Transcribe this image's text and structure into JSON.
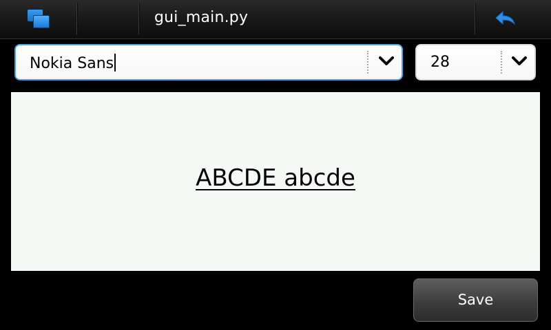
{
  "titlebar": {
    "task_switcher_icon": "task-switcher-icon",
    "title": "gui_main.py",
    "back_icon": "back-arrow-icon",
    "accent_color": "#2b8fe8"
  },
  "font_combo": {
    "value": "Nokia Sans",
    "icon": "chevron-down-icon",
    "focused": true
  },
  "size_combo": {
    "value": "28",
    "icon": "chevron-down-icon"
  },
  "preview": {
    "text": "ABCDE abcde"
  },
  "save_button": {
    "label": "Save"
  }
}
